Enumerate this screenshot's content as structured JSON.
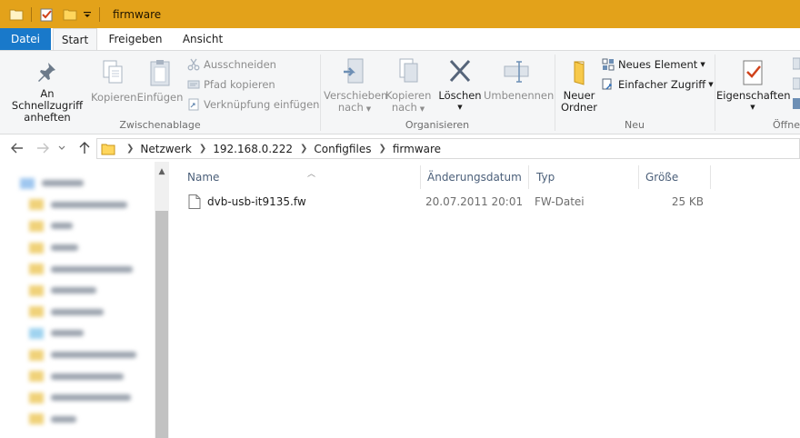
{
  "window": {
    "title": "firmware"
  },
  "tabs": {
    "datei": "Datei",
    "start": "Start",
    "freigeben": "Freigeben",
    "ansicht": "Ansicht"
  },
  "ribbon": {
    "pin_label1": "An Schnellzugriff",
    "pin_label2": "anheften",
    "copy": "Kopieren",
    "paste": "Einfügen",
    "cut": "Ausschneiden",
    "copy_path": "Pfad kopieren",
    "paste_shortcut": "Verknüpfung einfügen",
    "clipboard_group": "Zwischenablage",
    "move_to_1": "Verschieben",
    "move_to_2": "nach",
    "copy_to_1": "Kopieren",
    "copy_to_2": "nach",
    "delete": "Löschen",
    "rename": "Umbenennen",
    "organize_group": "Organisieren",
    "new_folder_1": "Neuer",
    "new_folder_2": "Ordner",
    "new_item": "Neues Element",
    "easy_access": "Einfacher Zugriff",
    "new_group": "Neu",
    "properties": "Eigenschaften",
    "open_group": "Öffne"
  },
  "address": {
    "crumbs": [
      "Netzwerk",
      "192.168.0.222",
      "Configfiles",
      "firmware"
    ]
  },
  "columns": {
    "name": "Name",
    "date": "Änderungsdatum",
    "type": "Typ",
    "size": "Größe"
  },
  "files": [
    {
      "name": "dvb-usb-it9135.fw",
      "date": "20.07.2011 20:01",
      "type": "FW-Datei",
      "size": "25 KB"
    }
  ],
  "colors": {
    "titlebar": "#e3a21a",
    "accent": "#1979ca",
    "ribbon_bg": "#f5f6f7"
  }
}
